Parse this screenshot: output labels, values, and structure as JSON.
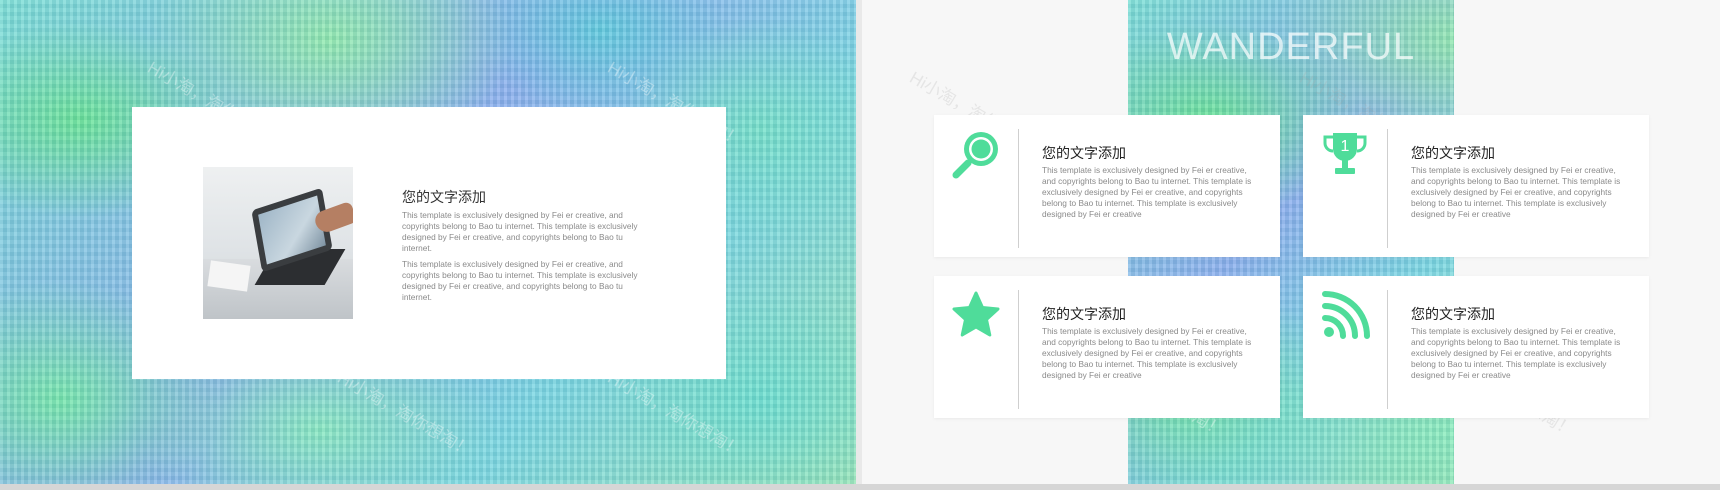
{
  "slide1": {
    "card": {
      "title": "您的文字添加",
      "paragraph1": "This template is exclusively designed by Fei er creative, and copyrights belong to Bao tu internet. This template is exclusively designed by Fei er creative, and copyrights belong to Bao tu internet.",
      "paragraph2": "This template is exclusively designed by Fei er creative, and copyrights belong to Bao tu internet. This template is exclusively designed by Fei er creative, and copyrights belong to Bao tu internet."
    }
  },
  "slide2": {
    "headline": "WANDERFUL",
    "accent_color": "#4fdc9a",
    "boxes": [
      {
        "icon": "search-icon",
        "title": "您的文字添加",
        "text": "This template is exclusively designed by Fei er creative, and copyrights belong to Bao tu internet. This template is exclusively designed by Fei er creative, and copyrights belong to Bao tu internet. This template is exclusively designed by Fei er creative"
      },
      {
        "icon": "trophy-icon",
        "title": "您的文字添加",
        "text": "This template is exclusively designed by Fei er creative, and copyrights belong to Bao tu internet. This template is exclusively designed by Fei er creative, and copyrights belong to Bao tu internet. This template is exclusively designed by Fei er creative"
      },
      {
        "icon": "star-icon",
        "title": "您的文字添加",
        "text": "This template is exclusively designed by Fei er creative, and copyrights belong to Bao tu internet. This template is exclusively designed by Fei er creative, and copyrights belong to Bao tu internet. This template is exclusively designed by Fei er creative"
      },
      {
        "icon": "rss-icon",
        "title": "您的文字添加",
        "text": "This template is exclusively designed by Fei er creative, and copyrights belong to Bao tu internet. This template is exclusively designed by Fei er creative, and copyrights belong to Bao tu internet. This template is exclusively designed by Fei er creative"
      }
    ],
    "trophy_number": "1"
  },
  "watermark": "Hi小淘，淘你想淘！"
}
